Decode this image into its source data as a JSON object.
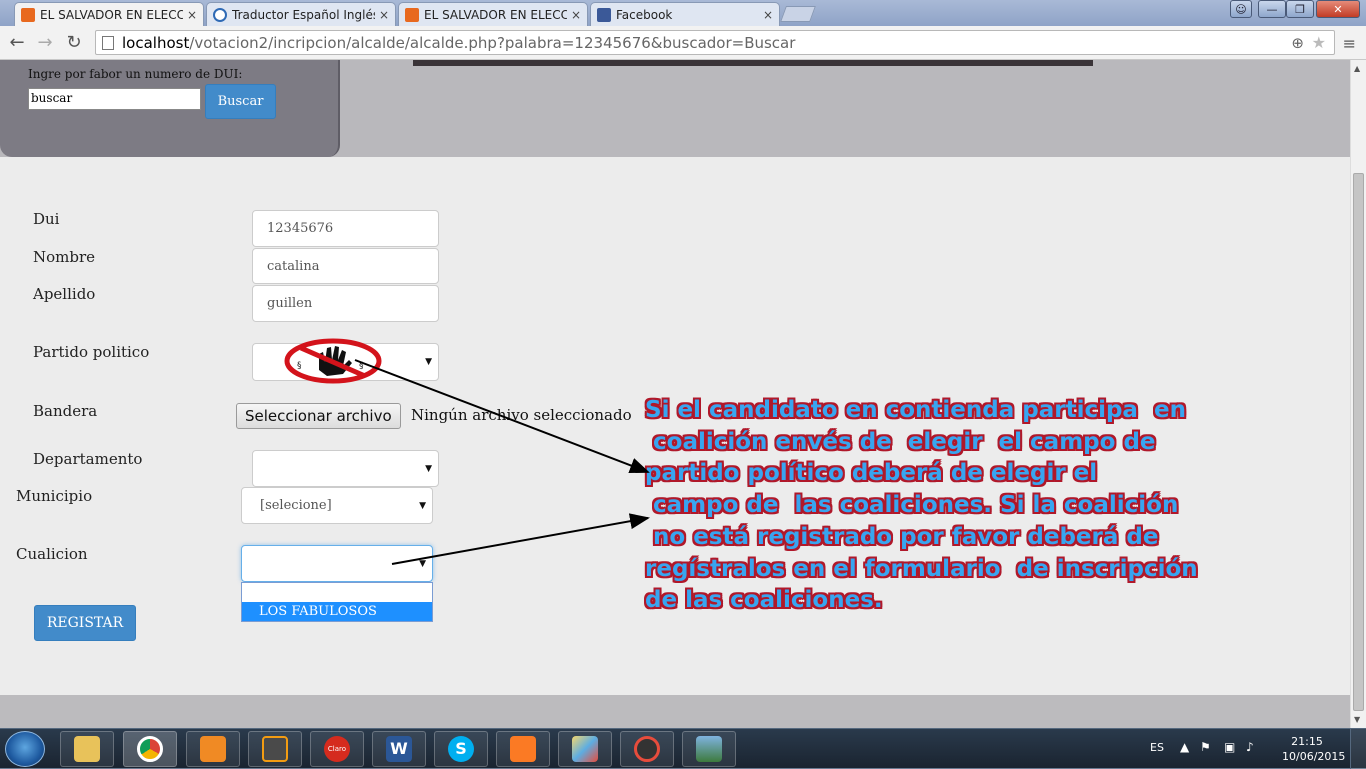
{
  "browser": {
    "tabs": [
      {
        "label": "EL SALVADOR EN ELECCIONES",
        "icon": "xampp-icon",
        "close": "×",
        "active": true
      },
      {
        "label": "Traductor Español Inglés",
        "icon": "bing-icon",
        "close": "×",
        "active": false
      },
      {
        "label": "EL SALVADOR EN ELECCIONES",
        "icon": "xampp-icon",
        "close": "×",
        "active": false
      },
      {
        "label": "Facebook",
        "icon": "facebook-icon",
        "close": "×",
        "active": false
      }
    ],
    "url_host": "localhost",
    "url_path": "/votacion2/incripcion/alcalde/alcalde.php?palabra=12345676&buscador=Buscar",
    "window_controls": {
      "minimize": "—",
      "maximize": "❐",
      "close": "✕"
    }
  },
  "search": {
    "prompt": "Ingre por fabor un numero de DUI:",
    "value": "buscar",
    "button": "Buscar"
  },
  "form": {
    "dui": {
      "label": "Dui",
      "value": "12345676"
    },
    "nombre": {
      "label": "Nombre",
      "value": "catalina"
    },
    "apellido": {
      "label": "Apellido",
      "value": "guillen"
    },
    "partido": {
      "label": "Partido politico"
    },
    "bandera": {
      "label": "Bandera",
      "button": "Seleccionar archivo",
      "status": "Ningún archivo seleccionado"
    },
    "departamento": {
      "label": "Departamento",
      "value": ""
    },
    "municipio": {
      "label": "Municipio",
      "value": "[selecione]"
    },
    "coalicion": {
      "label": "Cualicion",
      "value": "",
      "options": [
        "",
        "LOS FABULOSOS"
      ],
      "highlighted": "LOS FABULOSOS"
    },
    "submit": "REGISTAR"
  },
  "annotation": {
    "lines": [
      "Si el candidato en contienda participa  en",
      " coalición envés de  elegir  el campo de",
      "partido político deberá de elegir el",
      " campo de  las coaliciones. Si la coalición",
      " no está registrado por favor deberá de",
      "regístralos en el formulario  de inscripción",
      "de las coaliciones."
    ],
    "colors": {
      "fill": "#38a5f0",
      "outline": "#b0182a"
    }
  },
  "taskbar": {
    "apps": [
      "explorer-icon",
      "chrome-icon",
      "media-player-icon",
      "sublime-icon",
      "claro-icon",
      "word-icon",
      "skype-icon",
      "xampp-icon",
      "paint-icon",
      "recorder-icon",
      "photo-viewer-icon"
    ],
    "claro_label": "Claro",
    "language": "ES",
    "time": "21:15",
    "date": "10/06/2015"
  }
}
